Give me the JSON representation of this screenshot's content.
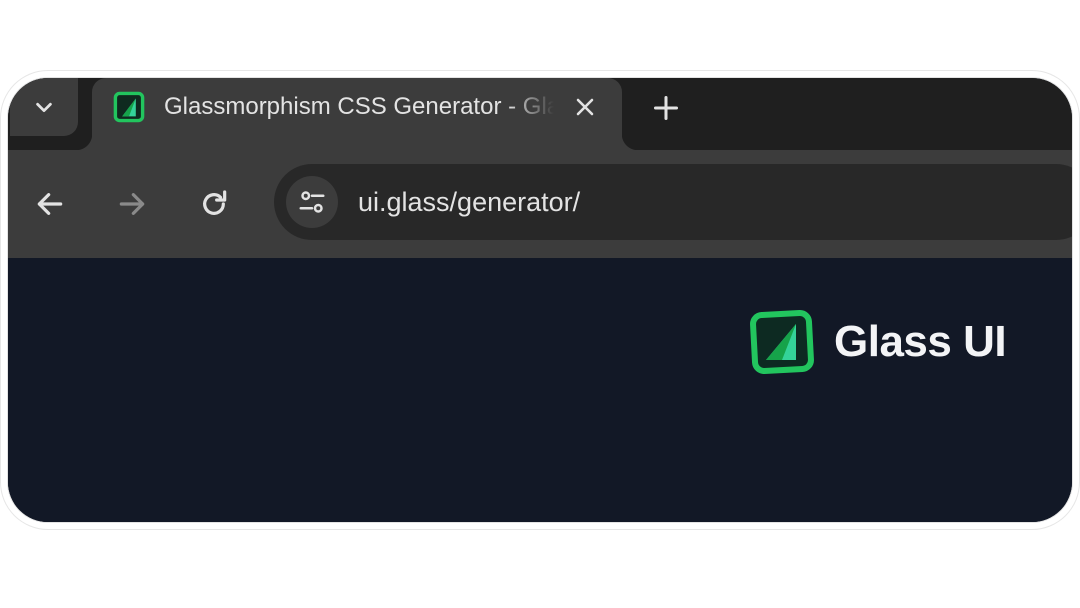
{
  "browser": {
    "tab_menu_icon": "chevron-down-icon",
    "tab": {
      "title": "Glassmorphism CSS Generator - Glass UI",
      "favicon": "glass-ui-logo-icon",
      "close_icon": "close-icon"
    },
    "new_tab_icon": "plus-icon",
    "nav": {
      "back_icon": "arrow-left-icon",
      "forward_icon": "arrow-right-icon",
      "reload_icon": "reload-icon"
    },
    "omnibox": {
      "site_info_icon": "tune-icon",
      "url": "ui.glass/generator/"
    }
  },
  "page": {
    "brand": {
      "name": "Glass UI",
      "logo": "glass-ui-logo-icon"
    }
  },
  "colors": {
    "tabstrip_bg": "#1f1f1f",
    "toolbar_bg": "#3c3c3c",
    "omnibox_bg": "#282828",
    "page_bg": "#121826",
    "brand_accent": "#22c55e",
    "brand_text": "#f3f4f6"
  }
}
